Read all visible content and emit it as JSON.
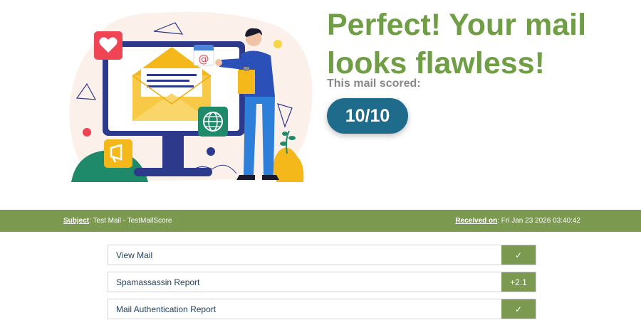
{
  "hero": {
    "headline": "Perfect! Your mail looks flawless!",
    "score_caption": "This mail scored:",
    "score": "10/10"
  },
  "subject_bar": {
    "subject_key": "Subject",
    "subject_value": ": Test Mail - TestMailScore",
    "received_key": "Received on",
    "received_value": ": Fri Jan 23 2026 03:40:42"
  },
  "reports": [
    {
      "label": "View Mail",
      "status": "✓",
      "status_icon": "check-icon"
    },
    {
      "label": "Spamassassin Report",
      "status": "+2.1",
      "status_icon": "score-badge"
    },
    {
      "label": "Mail Authentication Report",
      "status": "✓",
      "status_icon": "check-icon"
    }
  ],
  "colors": {
    "brand_green": "#6f9e45",
    "bar_green": "#7b9a4f",
    "score_blue": "#1f6b8c"
  }
}
